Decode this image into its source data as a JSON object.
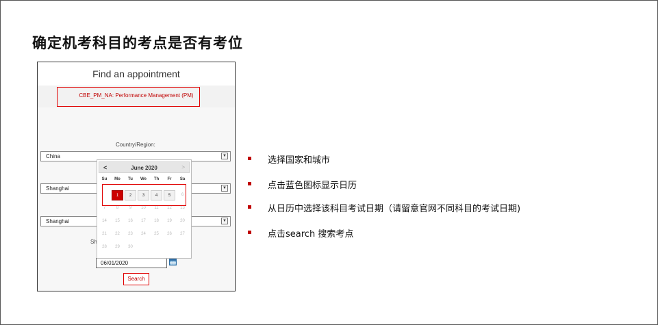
{
  "slide": {
    "title": "确定机考科目的考点是否有考位",
    "bullets": [
      "选择国家和城市",
      "点击蓝色图标显示日历",
      "从日历中选择该科目考试日期（请留意官网不同科目的考试日期)",
      "点击search 搜索考点"
    ],
    "accent_color": "#c00000"
  },
  "app": {
    "header_title": "Find an appointment",
    "exam_name": "CBE_PM_NA: Performance Management (PM)",
    "country_label": "Country/Region:",
    "country_value": "China",
    "city_value": "Shanghai",
    "center_value": "Shanghai",
    "partial_label": "Sh",
    "date_value": "06/01/2020",
    "search_label": "Search",
    "highlight_color": "#e00000"
  },
  "datepicker": {
    "prev": "<",
    "next": ">",
    "month_title": "June 2020",
    "weekdays": [
      "Su",
      "Mo",
      "Tu",
      "We",
      "Th",
      "Fr",
      "Sa"
    ],
    "weeks": [
      [
        "",
        "1",
        "2",
        "3",
        "4",
        "5",
        "6"
      ],
      [
        "7",
        "8",
        "9",
        "10",
        "11",
        "12",
        "13"
      ],
      [
        "14",
        "15",
        "16",
        "17",
        "18",
        "19",
        "20"
      ],
      [
        "21",
        "22",
        "23",
        "24",
        "25",
        "26",
        "27"
      ],
      [
        "28",
        "29",
        "30",
        "",
        "",
        "",
        ""
      ]
    ],
    "selected": "1",
    "available": [
      "1",
      "2",
      "3",
      "4",
      "5"
    ]
  }
}
